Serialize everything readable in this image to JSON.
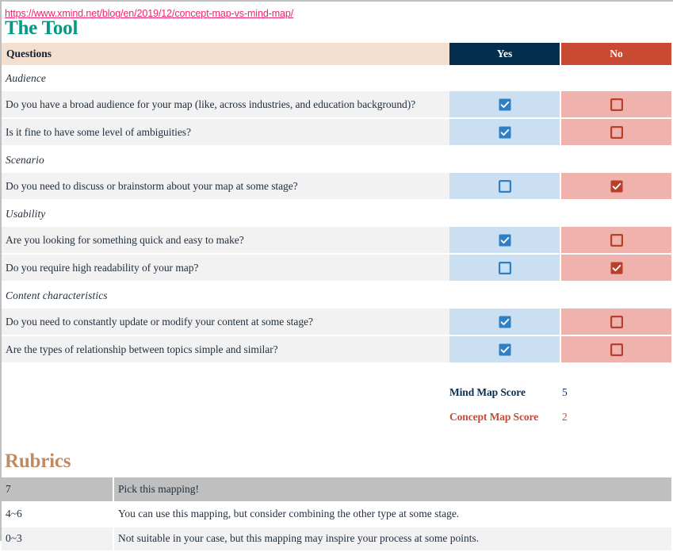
{
  "url": "https://www.xmind.net/blog/en/2019/12/concept-map-vs-mind-map/",
  "tool": {
    "title": "The Tool",
    "columns": {
      "questions": "Questions",
      "yes": "Yes",
      "no": "No"
    },
    "colors": {
      "header_questions_bg": "#F2DFD0",
      "header_yes_bg": "#042E4E",
      "header_no_bg": "#C94A32",
      "cell_yes_bg": "#CBDFF2",
      "cell_no_bg": "#EFB2AC",
      "checkbox_yes": "#2E7FC4",
      "checkbox_no": "#B8402B",
      "row_bg": "#F2F2F2",
      "title": "#009B82"
    },
    "sections": [
      {
        "label": "Audience",
        "questions": [
          {
            "text": "Do you have a broad audience for your map (like, across industries, and education background)?",
            "yes": true,
            "no": false
          },
          {
            "text": "Is it fine to have some level of ambiguities?",
            "yes": true,
            "no": false
          }
        ]
      },
      {
        "label": "Scenario",
        "questions": [
          {
            "text": "Do you need to discuss or brainstorm about your map at some stage?",
            "yes": false,
            "no": true
          }
        ]
      },
      {
        "label": "Usability",
        "questions": [
          {
            "text": "Are you looking for something quick and easy to make?",
            "yes": true,
            "no": false
          },
          {
            "text": "Do you require high readability of your map?",
            "yes": false,
            "no": true
          }
        ]
      },
      {
        "label": "Content characteristics",
        "questions": [
          {
            "text": "Do you need to constantly update or modify your content at some stage?",
            "yes": true,
            "no": false
          },
          {
            "text": "Are the types of relationship between topics simple and similar?",
            "yes": true,
            "no": false
          }
        ]
      }
    ]
  },
  "scores": {
    "mind_map_label": "Mind Map Score",
    "mind_map_value": "5",
    "concept_map_label": "Concept Map Score",
    "concept_map_value": "2"
  },
  "rubrics": {
    "title": "Rubrics",
    "title_color": "#C08A62",
    "rows": [
      {
        "score": "7",
        "advice": "Pick this mapping!"
      },
      {
        "score": "4~6",
        "advice": "You can use this mapping, but consider combining the other type at some stage."
      },
      {
        "score": "0~3",
        "advice": "Not suitable in your case, but this mapping may inspire your process at some points."
      }
    ]
  }
}
